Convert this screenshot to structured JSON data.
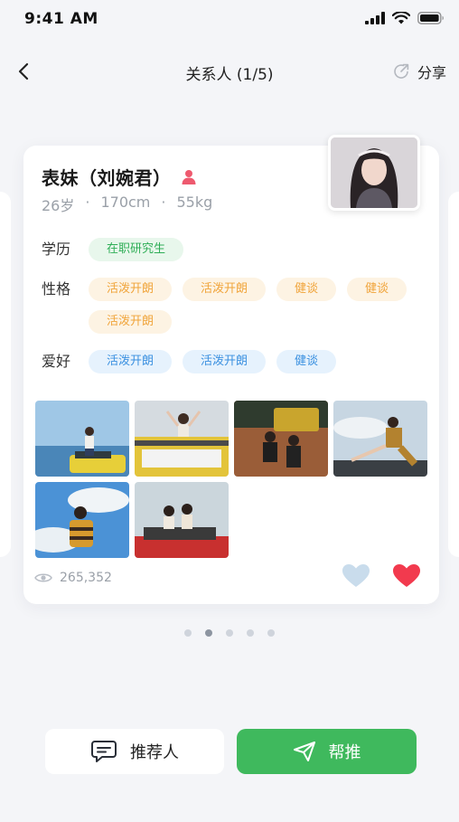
{
  "status_bar": {
    "time": "9:41 AM"
  },
  "nav": {
    "title": "关系人 (1/5)",
    "share_label": "分享"
  },
  "profile": {
    "name": "表妹（刘婉君）",
    "age": "26岁",
    "height": "170cm",
    "weight": "55kg"
  },
  "attributes": {
    "education": {
      "label": "学历",
      "tags": [
        "在职研究生"
      ]
    },
    "personality": {
      "label": "性格",
      "tags": [
        "活泼开朗",
        "活泼开朗",
        "健谈",
        "健谈",
        "活泼开朗"
      ]
    },
    "hobbies": {
      "label": "爱好",
      "tags": [
        "活泼开朗",
        "活泼开朗",
        "健谈"
      ]
    }
  },
  "stats": {
    "views": "265,352"
  },
  "pager": {
    "total": 5,
    "active_index": 1
  },
  "actions": {
    "recommender_label": "推荐人",
    "help_push_label": "帮推"
  },
  "colors": {
    "accent_green": "#3fb95d",
    "like_red": "#f23a4e",
    "gender_icon_red": "#ee5a6f"
  }
}
